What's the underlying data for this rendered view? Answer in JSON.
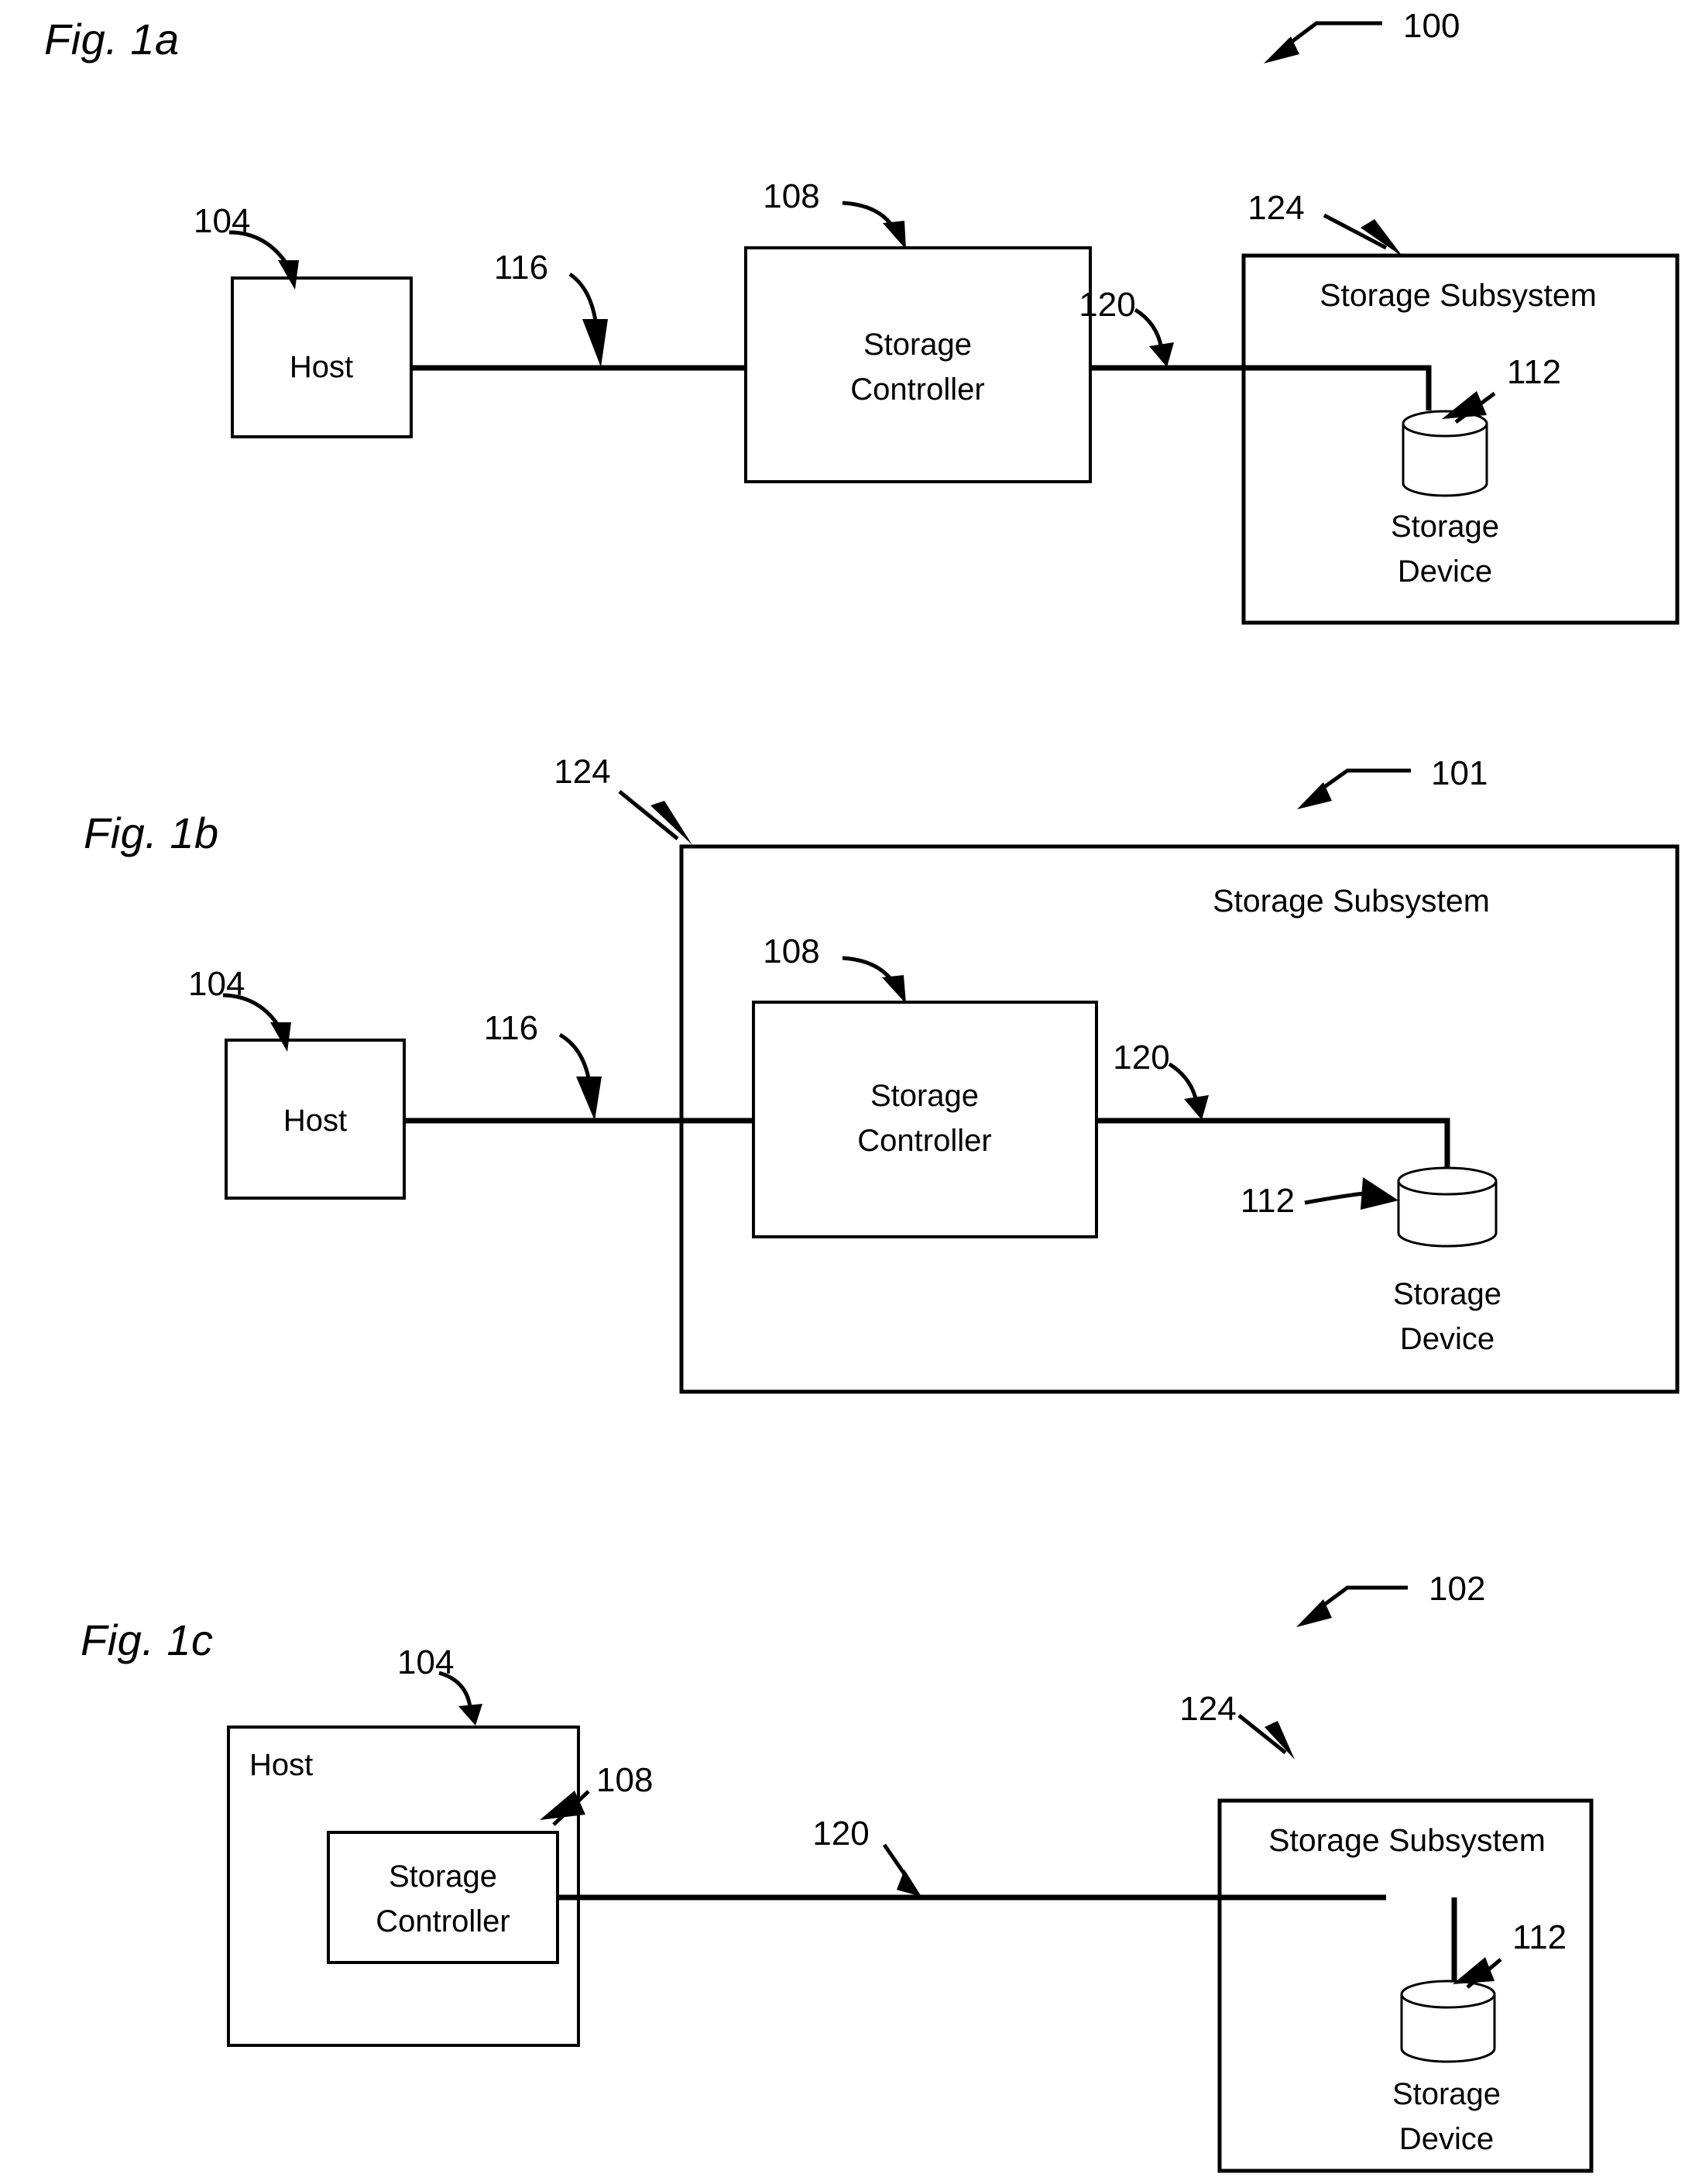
{
  "document": {
    "type": "patent-drawing-sheet",
    "sheet_background": "#ffffff",
    "ink_color": "#000000"
  },
  "figures": [
    {
      "id": "fig-1a",
      "label": "Fig. 1a",
      "system_ref": "100",
      "nodes": {
        "host": {
          "label": "Host",
          "ref": "104"
        },
        "storage_controller": {
          "label": "Storage\nController",
          "line1": "Storage",
          "line2": "Controller",
          "ref": "108"
        },
        "storage_subsystem": {
          "label": "Storage Subsystem",
          "ref": "124"
        },
        "storage_device": {
          "label": "Storage\nDevice",
          "line1": "Storage",
          "line2": "Device",
          "ref": "112"
        }
      },
      "links": [
        {
          "ref": "116",
          "from": "host",
          "to": "storage_controller"
        },
        {
          "ref": "120",
          "from": "storage_controller",
          "to": "storage_device"
        }
      ],
      "containment": "storage_device inside storage_subsystem"
    },
    {
      "id": "fig-1b",
      "label": "Fig. 1b",
      "system_ref": "101",
      "nodes": {
        "host": {
          "label": "Host",
          "ref": "104"
        },
        "storage_controller": {
          "label": "Storage\nController",
          "line1": "Storage",
          "line2": "Controller",
          "ref": "108"
        },
        "storage_subsystem": {
          "label": "Storage Subsystem",
          "ref": "124"
        },
        "storage_device": {
          "label": "Storage\nDevice",
          "line1": "Storage",
          "line2": "Device",
          "ref": "112"
        }
      },
      "links": [
        {
          "ref": "116",
          "from": "host",
          "to": "storage_controller"
        },
        {
          "ref": "120",
          "from": "storage_controller",
          "to": "storage_device"
        }
      ],
      "containment": "storage_controller and storage_device inside storage_subsystem"
    },
    {
      "id": "fig-1c",
      "label": "Fig. 1c",
      "system_ref": "102",
      "nodes": {
        "host": {
          "label": "Host",
          "ref": "104"
        },
        "storage_controller": {
          "label": "Storage\nController",
          "line1": "Storage",
          "line2": "Controller",
          "ref": "108"
        },
        "storage_subsystem": {
          "label": "Storage Subsystem",
          "ref": "124"
        },
        "storage_device": {
          "label": "Storage\nDevice",
          "line1": "Storage",
          "line2": "Device",
          "ref": "112"
        }
      },
      "links": [
        {
          "ref": "120",
          "from": "storage_controller",
          "to": "storage_device"
        }
      ],
      "containment": "storage_controller inside host; storage_device inside storage_subsystem"
    }
  ]
}
